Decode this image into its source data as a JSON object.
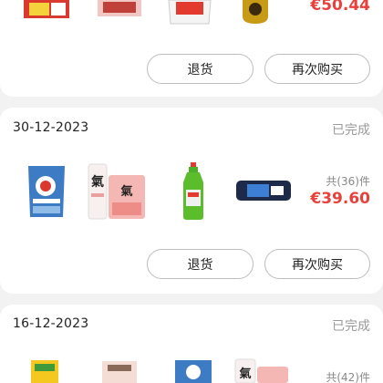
{
  "orders": [
    {
      "price": "€50.44",
      "return_label": "退货",
      "rebuy_label": "再次购买"
    },
    {
      "date": "30-12-2023",
      "status": "已完成",
      "count": "共(36)件",
      "price": "€39.60",
      "return_label": "退货",
      "rebuy_label": "再次购买"
    },
    {
      "date": "16-12-2023",
      "status": "已完成",
      "count": "共(42)件"
    }
  ],
  "colors": {
    "accent": "#e8413b",
    "muted": "#9a9a9a",
    "background": "#f2f2f2"
  }
}
